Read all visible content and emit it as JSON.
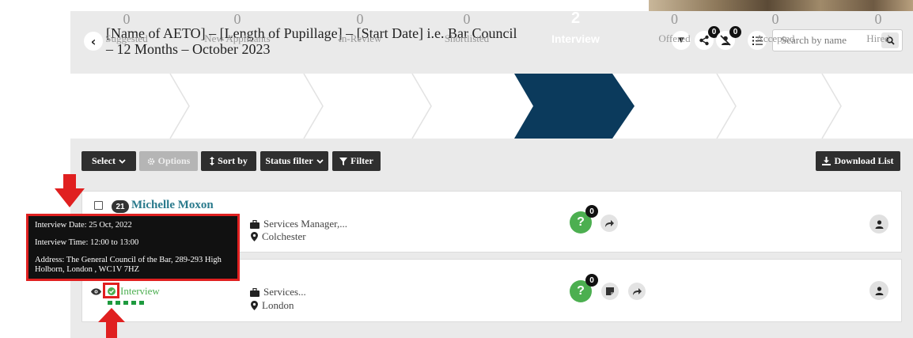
{
  "header": {
    "title": "[Name of AETO] – [Length of Pupillage] – [Start Date] i.e. Bar Council – 12 Months – October 2023",
    "share_count": "0",
    "reject_count": "0",
    "search_placeholder": "Search by name"
  },
  "pipeline": [
    {
      "count": "0",
      "label": "Suggested"
    },
    {
      "count": "0",
      "label": "New Applicants"
    },
    {
      "count": "0",
      "label": "In-Review"
    },
    {
      "count": "0",
      "label": "Shortlisted"
    },
    {
      "count": "2",
      "label": "Interview",
      "active": true
    },
    {
      "count": "0",
      "label": "Offered"
    },
    {
      "count": "0",
      "label": "Accepted"
    },
    {
      "count": "0",
      "label": "Hired"
    }
  ],
  "toolbar": {
    "select_label": "Select",
    "options_label": "Options",
    "sort_label": "Sort by",
    "status_filter_label": "Status filter",
    "filter_label": "Filter",
    "download_label": "Download List"
  },
  "candidates": [
    {
      "rank": "21",
      "name": "Michelle Moxon",
      "job": "Services Manager,...",
      "location": "Colchester",
      "question_count": "0"
    },
    {
      "status": "Interview",
      "job": "Services...",
      "location": "London",
      "question_count": "0"
    }
  ],
  "tooltip": {
    "date": "Interview Date: 25 Oct, 2022",
    "time": "Interview Time: 12:00 to 13:00",
    "address": "Address: The General Council of the Bar, 289-293 High Holborn, London , WC1V 7HZ"
  },
  "colors": {
    "active_stage": "#0b3a5c",
    "accent_green": "#4caf50",
    "annotation_red": "#e02020",
    "link": "#2a7a8c"
  }
}
